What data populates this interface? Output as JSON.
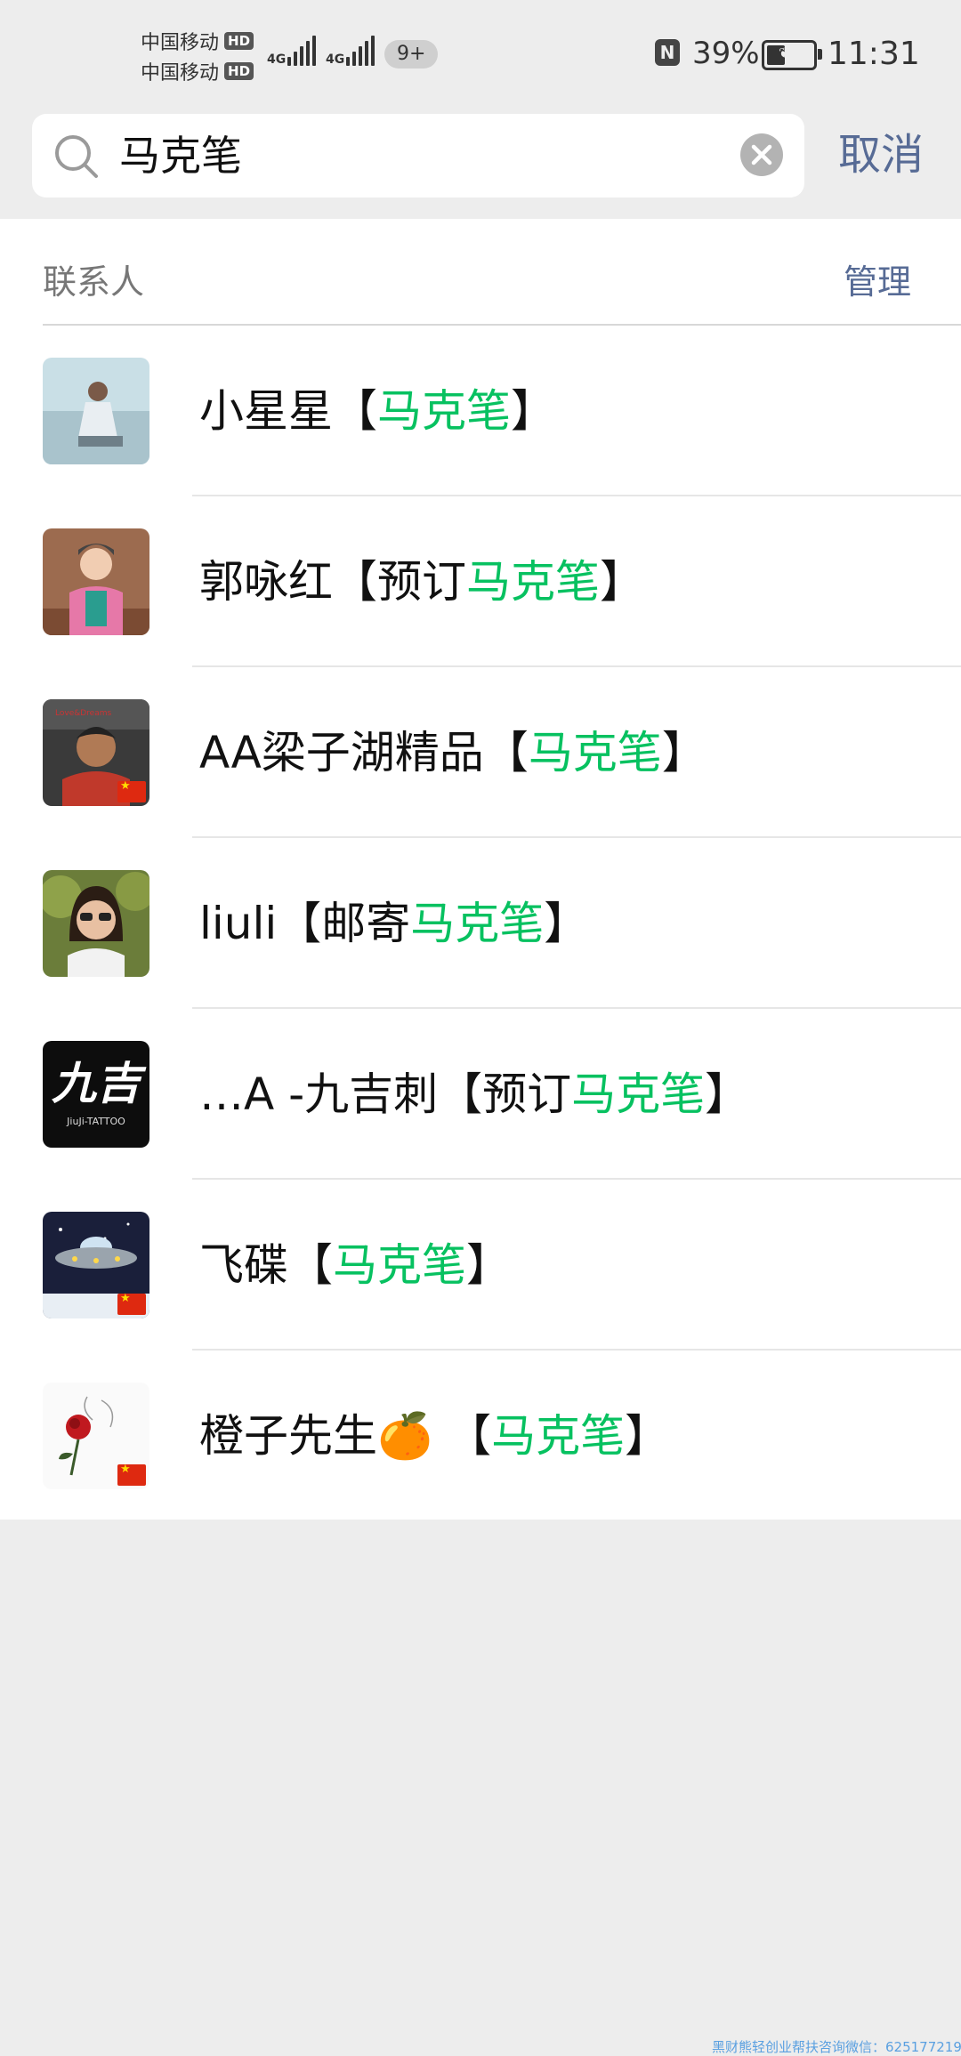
{
  "status_bar": {
    "carrier_1": "中国移动",
    "carrier_2": "中国移动",
    "hd_badge": "HD",
    "network": "4G",
    "notification_count": "9+",
    "nfc": "N",
    "battery_percent": "39%",
    "battery_level": 0.39,
    "time": "11:31"
  },
  "search": {
    "query": "马克笔",
    "cancel_label": "取消",
    "icon": "search-icon",
    "clear_icon": "clear-icon"
  },
  "results": {
    "section_title": "联系人",
    "manage_label": "管理",
    "highlight_color": "#07c160",
    "contacts": [
      {
        "name": "小星星",
        "before": "【",
        "highlight": "马克笔",
        "after": "】",
        "avatar": "avatar-photo-girl-lake",
        "flag": false
      },
      {
        "name": "郭咏红",
        "before": "【预订",
        "highlight": "马克笔",
        "after": "】",
        "avatar": "avatar-photo-child-pink",
        "flag": false
      },
      {
        "name": "AA梁子湖精品",
        "before": "【",
        "highlight": "马克笔",
        "after": "】",
        "avatar": "avatar-photo-man-car",
        "flag": true
      },
      {
        "name": "liuli",
        "before": "【邮寄",
        "highlight": "马克笔",
        "after": "】",
        "avatar": "avatar-photo-woman-sunglasses",
        "flag": false
      },
      {
        "name": "…A -九吉刺",
        "before": "【预订",
        "highlight": "马克笔",
        "after": "】",
        "avatar": "avatar-logo-jiuji-tattoo",
        "logo_text": "九吉",
        "logo_sub": "JiuJi-TATTOO",
        "flag": false
      },
      {
        "name": "飞碟",
        "before": "【",
        "highlight": "马克笔",
        "after": "】",
        "avatar": "avatar-ufo",
        "flag": true
      },
      {
        "name": "橙子先生🍊 ",
        "before": "【",
        "highlight": "马克笔",
        "after": "】",
        "avatar": "avatar-rose-sketch",
        "flag": true
      }
    ]
  },
  "watermark": "黑财熊轻创业帮扶咨询微信：625177219"
}
